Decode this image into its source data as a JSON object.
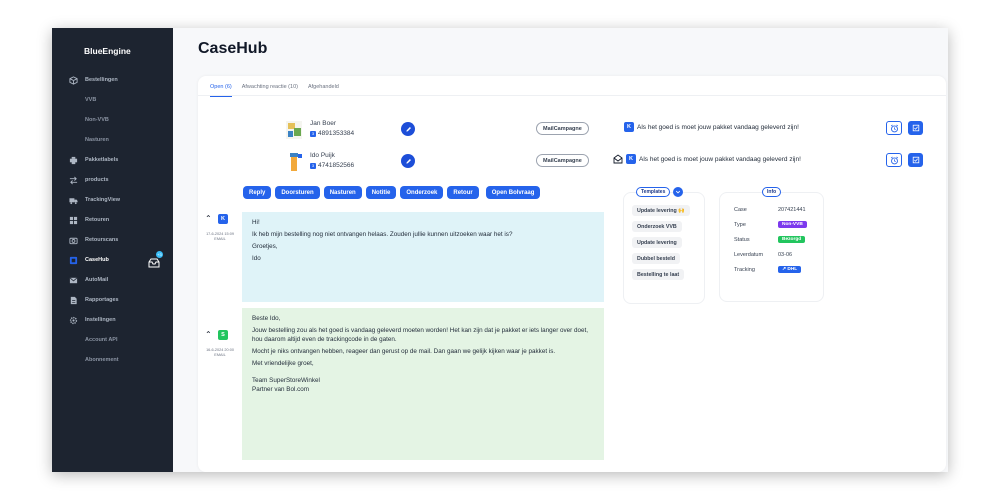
{
  "app": {
    "brand": "BlueEngine"
  },
  "sidebar": {
    "items": [
      {
        "label": "Bestellingen",
        "icon": "cube-icon",
        "sub": false
      },
      {
        "label": "VVB",
        "icon": "",
        "sub": true
      },
      {
        "label": "Non-VVB",
        "icon": "",
        "sub": true
      },
      {
        "label": "Nasturen",
        "icon": "",
        "sub": true
      },
      {
        "label": "Pakketlabels",
        "icon": "printer-icon",
        "sub": false
      },
      {
        "label": "products",
        "icon": "shuffle-icon",
        "sub": false
      },
      {
        "label": "TrackingView",
        "icon": "truck-icon",
        "sub": false
      },
      {
        "label": "Retouren",
        "icon": "grid-icon",
        "sub": false
      },
      {
        "label": "Retourscans",
        "icon": "camera-icon",
        "sub": false
      },
      {
        "label": "CaseHub",
        "icon": "casehub-icon",
        "sub": false,
        "active": true
      },
      {
        "label": "AutoMail",
        "icon": "mail-icon",
        "sub": false
      },
      {
        "label": "Rapportages",
        "icon": "document-icon",
        "sub": false
      },
      {
        "label": "Instellingen",
        "icon": "gear-icon",
        "sub": false
      },
      {
        "label": "Account API",
        "icon": "",
        "sub": true
      },
      {
        "label": "Abonnement",
        "icon": "",
        "sub": true
      }
    ],
    "casehub_badge": "+3"
  },
  "page": {
    "title": "CaseHub"
  },
  "tabs": [
    {
      "label": "Open (6)",
      "active": true
    },
    {
      "label": "Afwachting reactie (10)",
      "active": false
    },
    {
      "label": "Afgehandeld",
      "active": false
    }
  ],
  "cases": [
    {
      "name": "Jan Boer",
      "badge": "3",
      "phone": "4891353384",
      "campaign": "MailCampagne",
      "channel_badge": "K",
      "message": "Als het goed is moet jouw pakket vandaag geleverd zijn!"
    },
    {
      "name": "Ido Puijk",
      "badge": "3",
      "phone": "4741852566",
      "campaign": "MailCampagne",
      "channel_badge": "K",
      "message": "Als het goed is moet jouw pakket vandaag geleverd zijn!"
    }
  ],
  "actions": [
    "Reply",
    "Doorsturen",
    "Nasturen",
    "Notitie",
    "Onderzoek",
    "Retour",
    "Open Bolvraag"
  ],
  "messages": {
    "customer": {
      "avatar": "K",
      "avatar_color": "#2563eb",
      "date": "17-6-2024 15:09",
      "type": "EMAIL",
      "lines": [
        "Hi!",
        "Ik heb mijn bestelling nog niet ontvangen helaas. Zouden jullie kunnen uitzoeken waar het is?",
        "Groetjes,",
        "Ido"
      ]
    },
    "reply": {
      "avatar": "S",
      "avatar_color": "#22c55e",
      "date": "16-6-2024 20:00",
      "type": "EMAIL",
      "lines": [
        "Beste Ido,",
        "Jouw bestelling zou als het goed is vandaag geleverd moeten worden! Het kan zijn dat je pakket er iets langer over doet, hou daarom altijd even de trackingcode in de gaten.",
        "Mocht je niks ontvangen hebben, reageer dan gerust op de mail. Dan gaan we gelijk kijken waar je pakket is.",
        "Met vriendelijke groet,",
        "Team SuperStoreWinkel",
        "Partner van Bol.com"
      ]
    }
  },
  "templates": {
    "title": "Templates",
    "items": [
      "Update levering 🙌",
      "Onderzoek VVB",
      "Update levering",
      "Dubbel besteld",
      "Bestelling te laat"
    ]
  },
  "info": {
    "title": "Info",
    "case_label": "Case",
    "case_value": "207421441",
    "type_label": "Type",
    "type_value": "Non-VVB",
    "status_label": "Status",
    "status_value": "Bezorgd",
    "delivery_label": "Leverdatum",
    "delivery_value": "03-06",
    "tracking_label": "Tracking",
    "tracking_value": "DHL"
  },
  "colors": {
    "sidebar_bg": "#1d2430",
    "accent": "#2563eb",
    "type_chip": "#7c3aed",
    "status_chip": "#22c55e",
    "customer_bubble": "#dff3f8",
    "reply_bubble": "#e4f4e4"
  }
}
